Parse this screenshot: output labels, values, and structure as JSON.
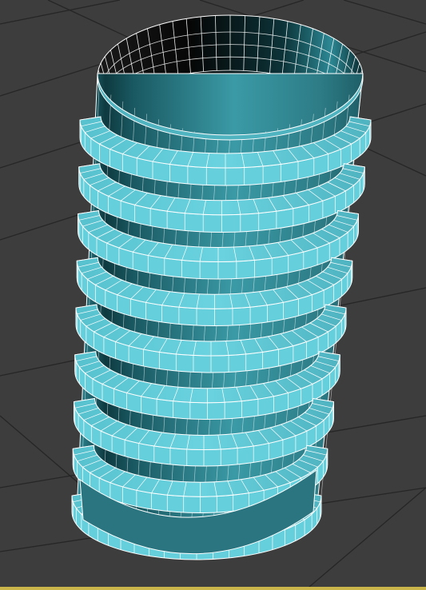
{
  "viewport": {
    "background_color": "#3d3d3d",
    "grid_color": "#262626",
    "active_border_color": "#c9b54a",
    "grid_visible": true,
    "active": true
  },
  "object": {
    "type": "threaded-cylinder",
    "display_mode": "shaded-with-edged-faces",
    "color_light": "#66cfdc",
    "color_mid": "#3a9aa6",
    "color_dark": "#0e3a40",
    "wire_color": "#ffffff",
    "thread_turns": 8
  }
}
